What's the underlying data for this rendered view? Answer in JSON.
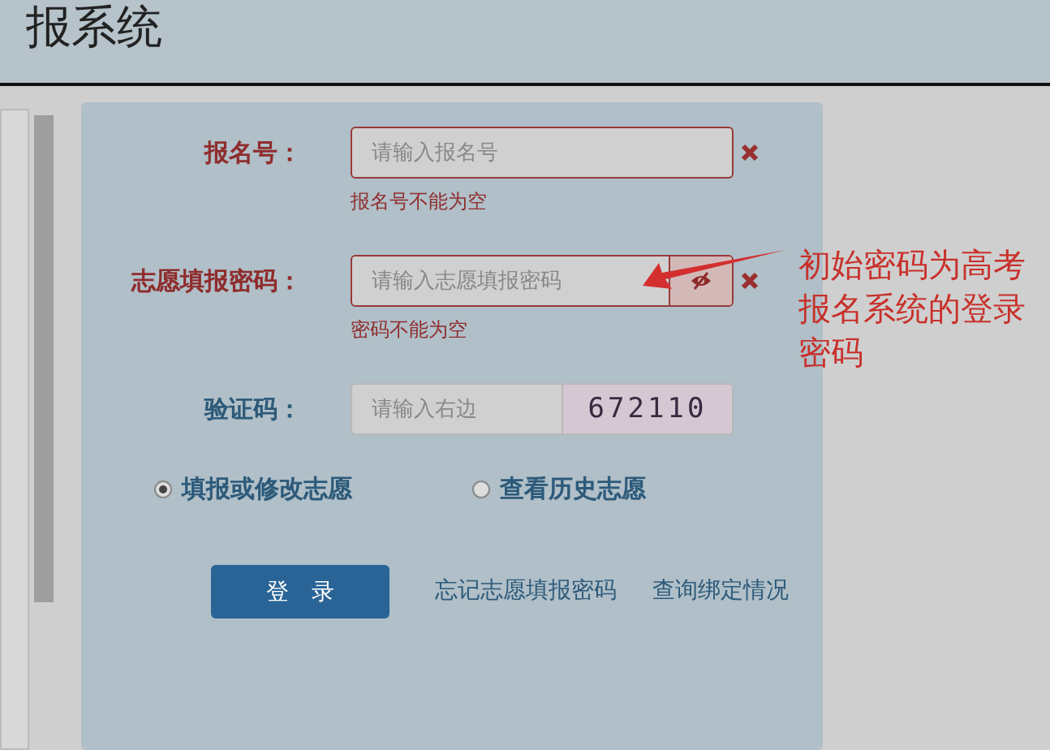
{
  "header": {
    "title": "报系统"
  },
  "form": {
    "fields": [
      {
        "kind": "text",
        "label": "报名号：",
        "placeholder": "请输入报名号",
        "error": "报名号不能为空"
      },
      {
        "kind": "password",
        "label": "志愿填报密码：",
        "placeholder": "请输入志愿填报密码",
        "error": "密码不能为空"
      },
      {
        "kind": "captcha",
        "label": "验证码：",
        "placeholder": "请输入右边",
        "captcha": "672110"
      }
    ],
    "radios": [
      {
        "label": "填报或修改志愿",
        "selected": true
      },
      {
        "label": "查看历史志愿",
        "selected": false
      }
    ],
    "login_button": "登　录",
    "links": [
      "忘记志愿填报密码",
      "查询绑定情况"
    ]
  },
  "annotation": "初始密码为高考报名系统的登录密码"
}
